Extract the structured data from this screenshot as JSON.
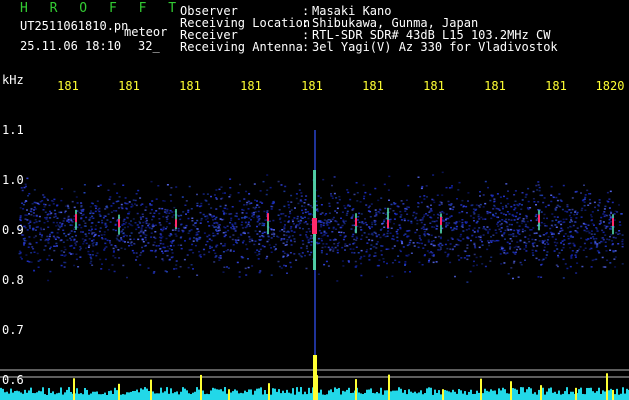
{
  "header": {
    "title": "H R O F F T",
    "filename": "UT2511061810.pn",
    "mode": "meteor",
    "datetime": "25.11.06 18:10",
    "count": "32_",
    "info": [
      {
        "label": "Observer",
        "sep": ":",
        "value": "Masaki Kano"
      },
      {
        "label": "Receiving Location",
        "sep": ":",
        "value": "Shibukawa, Gunma, Japan"
      },
      {
        "label": "Receiver",
        "sep": ":",
        "value": "RTL-SDR SDR# 43dB L15 103.2MHz CW"
      },
      {
        "label": "Receiving Antenna",
        "sep": ":",
        "value": "3el Yagi(V) Az 330 for Vladivostok"
      }
    ]
  },
  "axes": {
    "y_unit": "kHz",
    "y_ticks": [
      "1.1",
      "1.0",
      "0.9",
      "0.8",
      "0.7",
      "0.6"
    ],
    "x_ticks": [
      "181",
      "181",
      "181",
      "181",
      "181",
      "181",
      "181",
      "181",
      "181",
      "1820"
    ]
  },
  "colors": {
    "background": "#000000",
    "noise": "#1a2dbf",
    "echo": "#ff2a6a",
    "spike": "#ffff33",
    "floor": "#22d8e8",
    "gridline": "#bbbbbb"
  }
}
